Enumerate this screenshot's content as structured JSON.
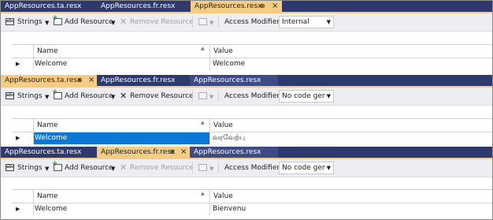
{
  "panels": [
    {
      "tabs": [
        {
          "label": "AppResources.ta.resx"
        },
        {
          "label": "AppResources.fr.resx"
        },
        {
          "label": "AppResources.resx",
          "pin": "⊕",
          "close": "×"
        }
      ],
      "toolbar": {
        "strings_label": "Strings",
        "add_resource_label": "Add Resource",
        "remove_resource_label": "Remove Resource",
        "access_modifier_label": "Access Modifier:",
        "access_modifier_value": "Internal"
      },
      "grid": {
        "name_header": "Name",
        "value_header": "Value",
        "rows": [
          {
            "name": "Welcome",
            "value": "Welcome"
          }
        ]
      }
    },
    {
      "tabs": [
        {
          "label": "AppResources.ta.resx",
          "pin": "⊕",
          "close": "×"
        },
        {
          "label": "AppResources.fr.resx"
        },
        {
          "label": "AppResources.resx"
        }
      ],
      "toolbar": {
        "strings_label": "Strings",
        "add_resource_label": "Add Resource",
        "remove_resource_label": "Remove Resource",
        "access_modifier_label": "Access Modifier:",
        "access_modifier_value": "No code gene"
      },
      "grid": {
        "name_header": "Name",
        "value_header": "Value",
        "rows": [
          {
            "name": "Welcome",
            "value": "வரவேற்பு"
          }
        ]
      }
    },
    {
      "tabs": [
        {
          "label": "AppResources.ta.resx"
        },
        {
          "label": "AppResources.fr.resx",
          "pin": "⊕",
          "close": "×"
        },
        {
          "label": "AppResources.resx"
        }
      ],
      "toolbar": {
        "strings_label": "Strings",
        "add_resource_label": "Add Resource",
        "remove_resource_label": "Remove Resource",
        "access_modifier_label": "Access Modifier:",
        "access_modifier_value": "No code gene"
      },
      "grid": {
        "name_header": "Name",
        "value_header": "Value",
        "rows": [
          {
            "name": "Welcome",
            "value": "Bienvenu"
          }
        ]
      }
    }
  ]
}
